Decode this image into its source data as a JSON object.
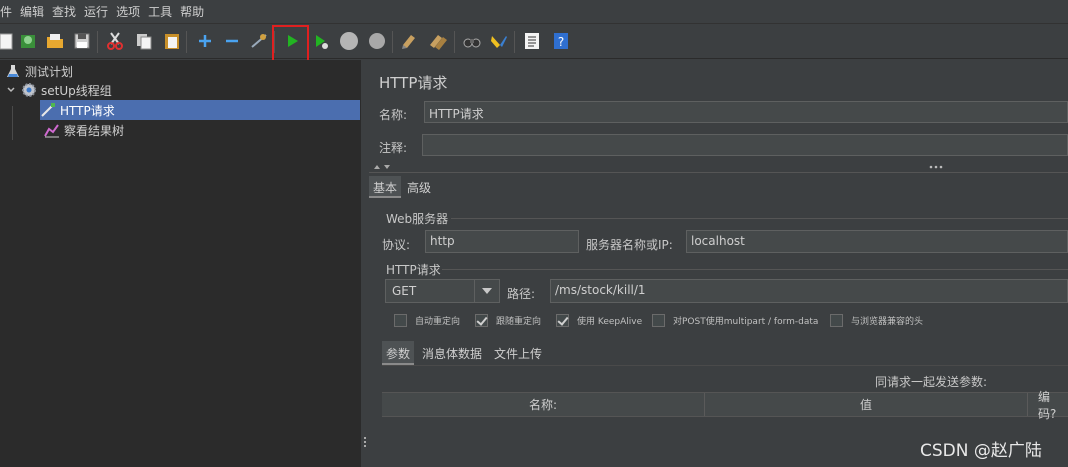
{
  "menu": [
    "件",
    "编辑",
    "查找",
    "运行",
    "选项",
    "工具",
    "帮助"
  ],
  "toolbar": {
    "icons": [
      "new-icon",
      "templates-icon",
      "open-icon",
      "save-icon",
      "cut-icon",
      "copy-icon",
      "paste-icon",
      "expand-icon",
      "collapse-icon",
      "toggle-icon",
      "start-icon",
      "start-no-pause-icon",
      "stop-icon",
      "shutdown-icon",
      "clear-icon",
      "clear-all-icon",
      "search-icon",
      "reset-search-icon",
      "function-helper-icon",
      "help-icon"
    ],
    "accent_highlight": "#e02020"
  },
  "tree": {
    "items": [
      {
        "label": "测试计划",
        "icon": "flask-icon"
      },
      {
        "label": "setUp线程组",
        "icon": "gear-icon"
      },
      {
        "label": "HTTP请求",
        "icon": "pipette-icon",
        "selected": true
      },
      {
        "label": "察看结果树",
        "icon": "chart-icon"
      }
    ],
    "selected_color": "#4b6eaf"
  },
  "panel": {
    "title": "HTTP请求",
    "name_label": "名称:",
    "name_value": "HTTP请求",
    "comment_label": "注释:",
    "comment_value": "",
    "tabs": [
      "基本",
      "高级"
    ],
    "web_server": {
      "section": "Web服务器",
      "protocol_label": "协议:",
      "protocol_value": "http",
      "server_label": "服务器名称或IP:",
      "server_value": "localhost"
    },
    "http_request": {
      "section": "HTTP请求",
      "method": "GET",
      "path_label": "路径:",
      "path_value": "/ms/stock/kill/1"
    },
    "checkboxes": [
      {
        "label": "自动重定向",
        "checked": false
      },
      {
        "label": "跟随重定向",
        "checked": true
      },
      {
        "label": "使用 KeepAlive",
        "checked": true
      },
      {
        "label": "对POST使用multipart / form-data",
        "checked": false
      },
      {
        "label": "与浏览器兼容的头",
        "checked": false
      }
    ],
    "param_tabs": [
      "参数",
      "消息体数据",
      "文件上传"
    ],
    "send_params_label": "同请求一起发送参数:",
    "table_headers": [
      "名称:",
      "值",
      "编码?"
    ]
  },
  "watermark": "CSDN @赵广陆"
}
